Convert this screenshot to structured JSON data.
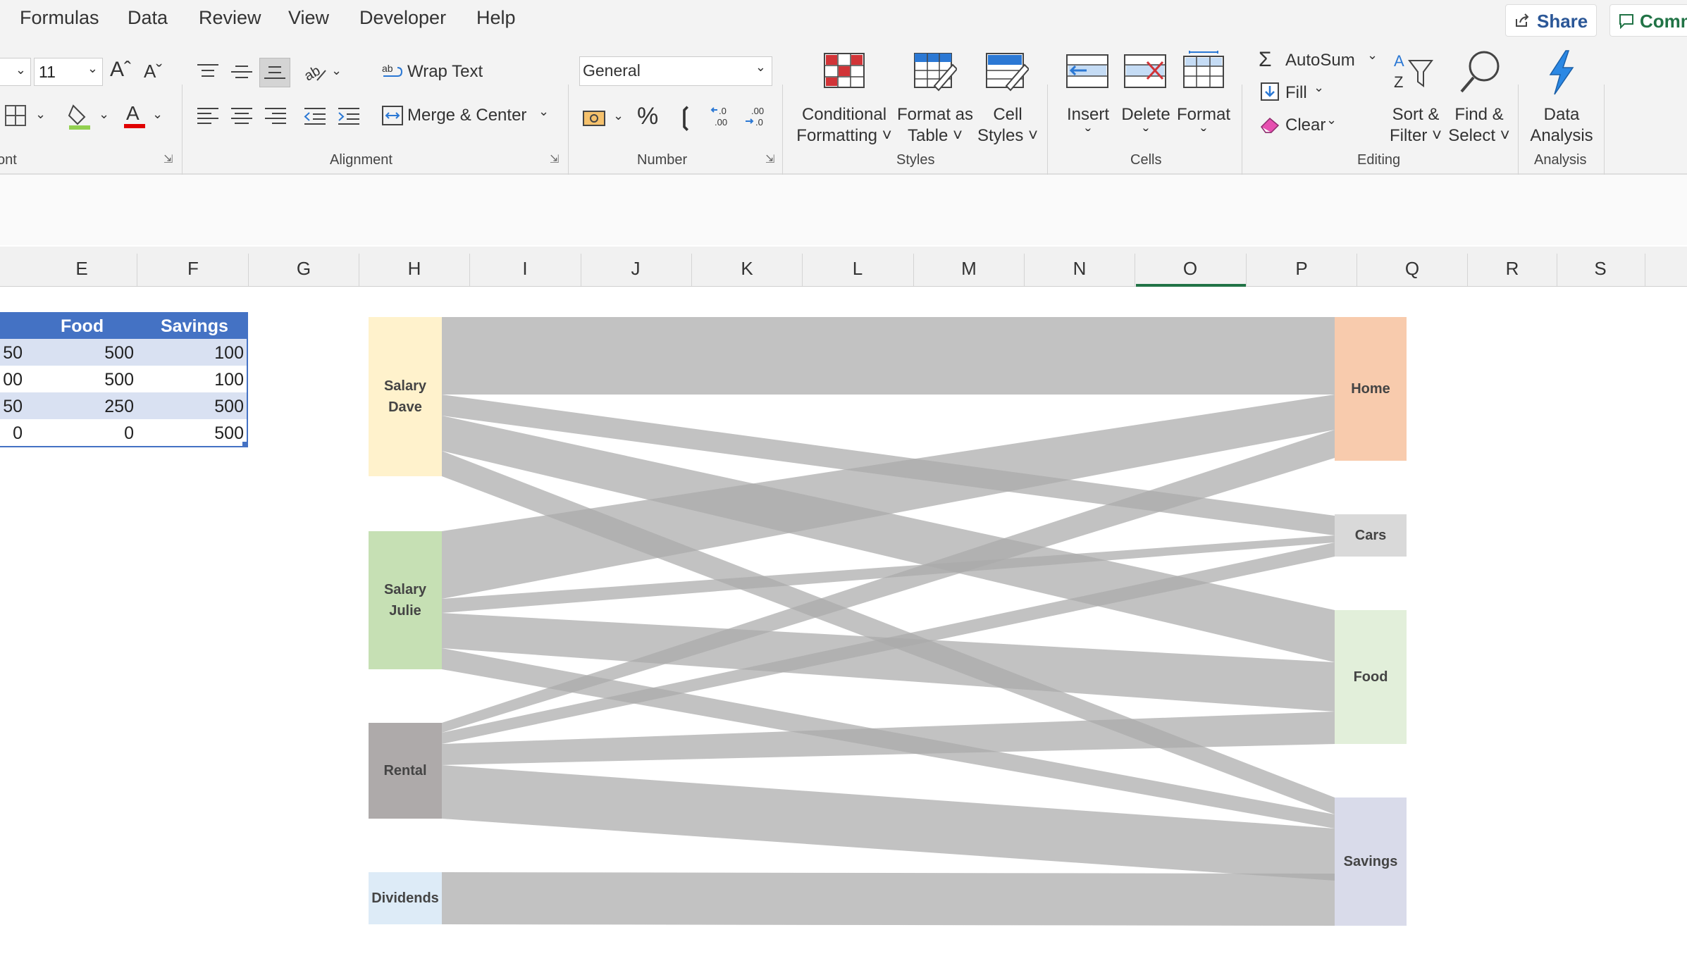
{
  "menu": {
    "formulas": "Formulas",
    "data": "Data",
    "review": "Review",
    "view": "View",
    "developer": "Developer",
    "help": "Help",
    "share": "Share",
    "comments": "Comm"
  },
  "ribbon": {
    "font_size": "11",
    "wrap_text": "Wrap Text",
    "merge_center": "Merge & Center",
    "number_format": "General",
    "percent": "%",
    "comma": ")",
    "conditional_formatting": [
      "Conditional",
      "Formatting ˅"
    ],
    "format_as_table": [
      "Format as",
      "Table ˅"
    ],
    "cell_styles": [
      "Cell",
      "Styles ˅"
    ],
    "insert": "Insert",
    "delete": "Delete",
    "format": "Format",
    "autosum": "AutoSum",
    "fill": "Fill",
    "clear": "Clear",
    "sort_filter": [
      "Sort &",
      "Filter ˅"
    ],
    "find_select": [
      "Find &",
      "Select ˅"
    ],
    "data_analysis": [
      "Data",
      "Analysis"
    ],
    "groups": {
      "font": "ont",
      "alignment": "Alignment",
      "number": "Number",
      "styles": "Styles",
      "cells": "Cells",
      "editing": "Editing",
      "analysis": "Analysis"
    },
    "colors": {
      "accent_red": "#d13438",
      "accent_blue": "#2b78d4",
      "fill_yellow": "#92d050",
      "font_red": "#e00000"
    }
  },
  "columns": [
    "E",
    "F",
    "G",
    "H",
    "I",
    "J",
    "K",
    "L",
    "M",
    "N",
    "O",
    "P",
    "Q",
    "R",
    "S"
  ],
  "table": {
    "headers": [
      "Food",
      "Savings"
    ],
    "rows": [
      {
        "partial": "50",
        "food": "500",
        "savings": "100"
      },
      {
        "partial": "00",
        "food": "500",
        "savings": "100"
      },
      {
        "partial": "50",
        "food": "250",
        "savings": "500"
      },
      {
        "partial": "0",
        "food": "0",
        "savings": "500"
      }
    ],
    "header_color": "#4472c4",
    "band_color": "#d9e1f2"
  },
  "sankey": {
    "sources": [
      {
        "label": [
          "Salary",
          "Dave"
        ],
        "color": "#fff2cc"
      },
      {
        "label": [
          "Salary",
          "Julie"
        ],
        "color": "#c6e0b4"
      },
      {
        "label": [
          "Rental"
        ],
        "color": "#aeaaaa"
      },
      {
        "label": [
          "Dividends"
        ],
        "color": "#ddebf7"
      }
    ],
    "targets": [
      {
        "label": [
          "Home"
        ],
        "color": "#f8cbad"
      },
      {
        "label": [
          "Cars"
        ],
        "color": "#d9d9d9"
      },
      {
        "label": [
          "Food"
        ],
        "color": "#e2efda"
      },
      {
        "label": [
          "Savings"
        ],
        "color": "#d9dbea"
      }
    ],
    "flow_color": "#aaaaaa"
  }
}
